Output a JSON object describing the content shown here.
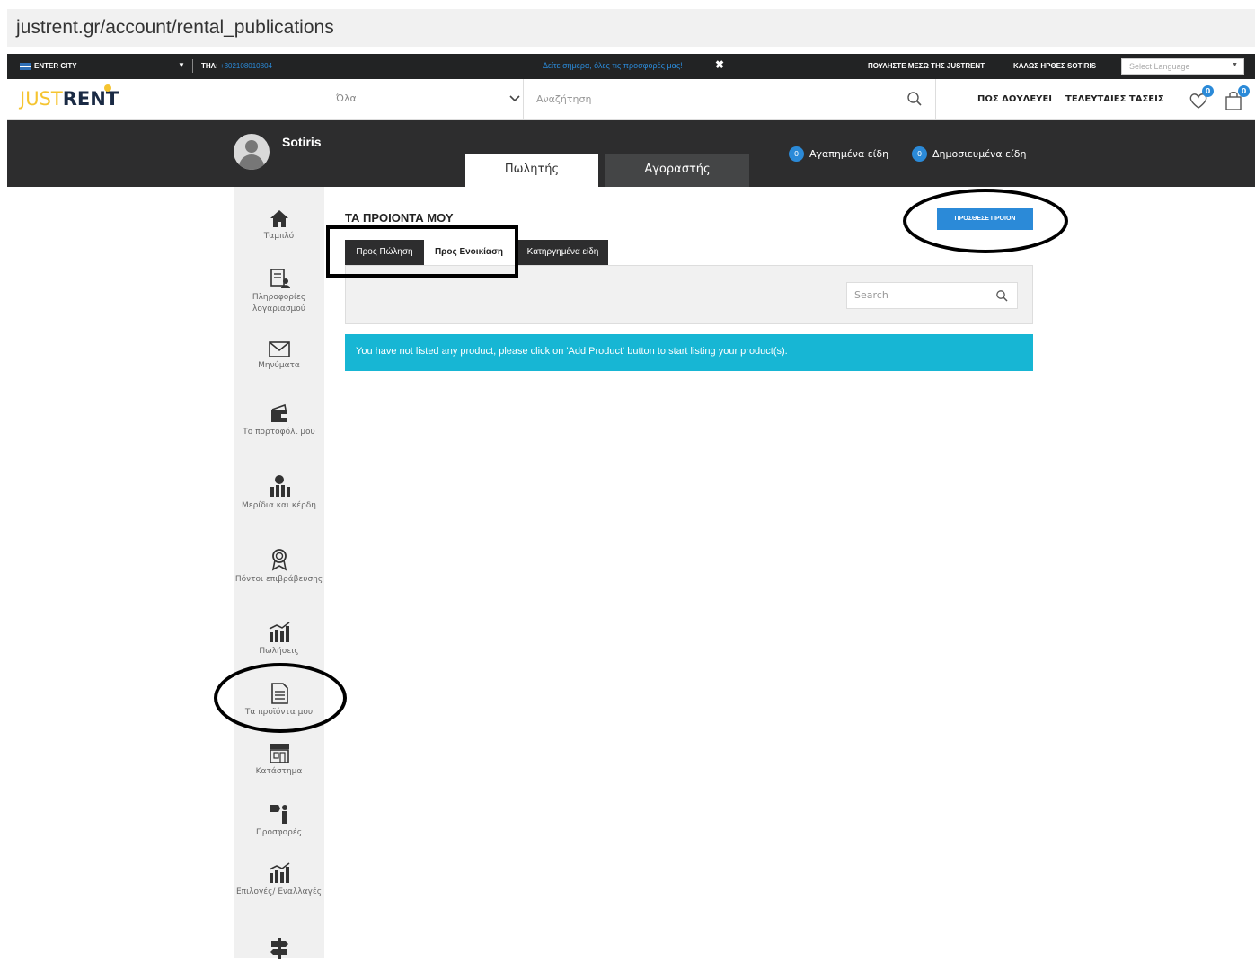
{
  "browser": {
    "url": "justrent.gr/account/rental_publications"
  },
  "topbar": {
    "city": "ENTER CITY",
    "phone_label": "ΤΗΛ:",
    "phone": "+302108010804",
    "promo": "Δείτε σήμερα, όλες τις προσφορές μας!",
    "close": "✖",
    "sell_link": "ΠΟΥΛΗΣΤΕ ΜΕΣΩ ΤΗΣ JUSTRENT",
    "hello": "ΚΑΛΩΣ ΗΡΘΕΣ SOTIRIS",
    "language_placeholder": "Select Language"
  },
  "header": {
    "logo_just": "JUST",
    "logo_rent": "RENT",
    "category": "Όλα",
    "search_placeholder": "Αναζήτηση",
    "nav_how": "ΠΩΣ ΔΟΥΛΕΥΕΙ",
    "nav_latest": "ΤΕΛΕΥΤΑΙΕΣ ΤΑΣΕΙΣ",
    "wishlist_count": "0",
    "cart_count": "0"
  },
  "profile": {
    "name": "Sotiris",
    "tab_seller": "Πωλητής",
    "tab_buyer": "Αγοραστής",
    "favorites_count": "0",
    "favorites_label": "Αγαπημένα είδη",
    "published_count": "0",
    "published_label": "Δημοσιευμένα είδη"
  },
  "sidebar": {
    "items": [
      {
        "label": "Ταμπλό",
        "icon": "home-icon"
      },
      {
        "label": "Πληροφορίες λογαριασμού",
        "icon": "account-info-icon"
      },
      {
        "label": "Μηνύματα",
        "icon": "envelope-icon"
      },
      {
        "label": "Το πορτοφόλι μου",
        "icon": "wallet-icon"
      },
      {
        "label": "Μερίδια και κέρδη",
        "icon": "earnings-icon"
      },
      {
        "label": "Πόντοι επιβράβευσης",
        "icon": "award-icon"
      },
      {
        "label": "Πωλήσεις",
        "icon": "sales-icon"
      },
      {
        "label": "Τα προϊόντα μου",
        "icon": "document-icon"
      },
      {
        "label": "Κατάστημα",
        "icon": "store-icon"
      },
      {
        "label": "Προσφορές",
        "icon": "offers-icon"
      },
      {
        "label": "Επιλογές/ Εναλλαγές",
        "icon": "options-icon"
      }
    ]
  },
  "main": {
    "title": "ΤΑ ΠΡΟΙΟΝΤΑ ΜΟΥ",
    "add_button": "ΠΡΟΣΘΕΣΕ ΠΡΟΙΟΝ",
    "tabs": [
      "Προς Πώληση",
      "Προς Ενοικίαση",
      "Κατηργημένα είδη"
    ],
    "search_placeholder": "Search",
    "notice": "You have not listed any product, please click on 'Add Product' button to start listing your product(s)."
  },
  "colors": {
    "accent": "#2b8ad8",
    "notice": "#17b6d4",
    "dark": "#2d2d2e",
    "logo_yellow": "#f5c430"
  }
}
